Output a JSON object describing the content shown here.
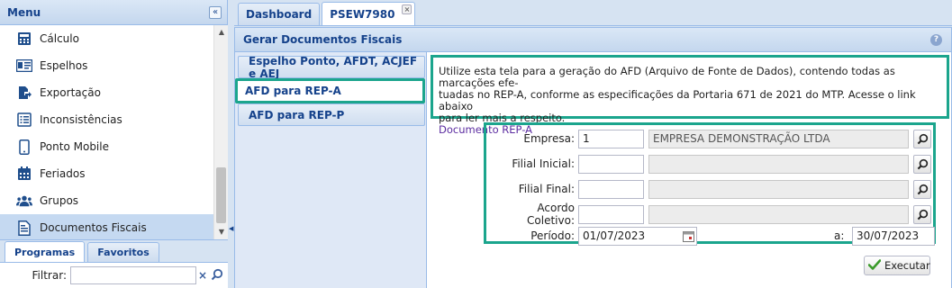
{
  "left_panel": {
    "title": "Menu",
    "collapse_symbol": "«",
    "menu_items": [
      {
        "label": "Cálculo",
        "icon": "calculator-icon"
      },
      {
        "label": "Espelhos",
        "icon": "id-card-icon"
      },
      {
        "label": "Exportação",
        "icon": "file-export-icon"
      },
      {
        "label": "Inconsistências",
        "icon": "list-icon"
      },
      {
        "label": "Ponto Mobile",
        "icon": "mobile-phone-icon"
      },
      {
        "label": "Feriados",
        "icon": "calendar-icon"
      },
      {
        "label": "Grupos",
        "icon": "users-icon"
      },
      {
        "label": "Documentos Fiscais",
        "icon": "document-icon"
      }
    ],
    "active_item": "Documentos Fiscais",
    "bottom_tabs": [
      "Programas",
      "Favoritos"
    ],
    "active_bottom_tab": "Programas",
    "filter_label": "Filtrar:",
    "filter_value": "",
    "clear_symbol": "×"
  },
  "main": {
    "tabs": [
      {
        "label": "Dashboard"
      },
      {
        "label": "PSEW7980"
      }
    ],
    "active_tab": "PSEW7980",
    "close_symbol": "×",
    "panel_title": "Gerar Documentos Fiscais",
    "help_symbol": "?",
    "side_tabs": [
      {
        "label": "Espelho Ponto, AFDT, ACJEF e AEJ"
      },
      {
        "label": "AFD para REP-A"
      },
      {
        "label": "AFD para REP-P"
      }
    ],
    "active_side_tab": "AFD para REP-A",
    "info_text_1": "Utilize esta tela para a geração do AFD (Arquivo de Fonte de Dados), contendo todas as marcações efe-",
    "info_text_2": "tuadas no REP-A, conforme as especificações da Portaria 671 de 2021 do MTP. Acesse o link abaixo",
    "info_text_3": "para ler mais a respeito.",
    "info_link": "Documento REP-A",
    "form": {
      "empresa_label": "Empresa:",
      "empresa_code": "1",
      "empresa_desc": "EMPRESA DEMONSTRAÇÃO LTDA",
      "filial_inicial_label": "Filial Inicial:",
      "filial_inicial_code": "",
      "filial_inicial_desc": "",
      "filial_final_label": "Filial Final:",
      "filial_final_code": "",
      "filial_final_desc": "",
      "acordo_label": "Acordo Coletivo:",
      "acordo_code": "",
      "acordo_desc": "",
      "periodo_label": "Período:",
      "periodo_inicio": "01/07/2023",
      "ate_label": "a:",
      "periodo_fim": "30/07/2023"
    },
    "execute_label": "Executar"
  },
  "colors": {
    "highlight": "#1ba58d",
    "header_text": "#15428b",
    "link": "#5b2ca0"
  }
}
